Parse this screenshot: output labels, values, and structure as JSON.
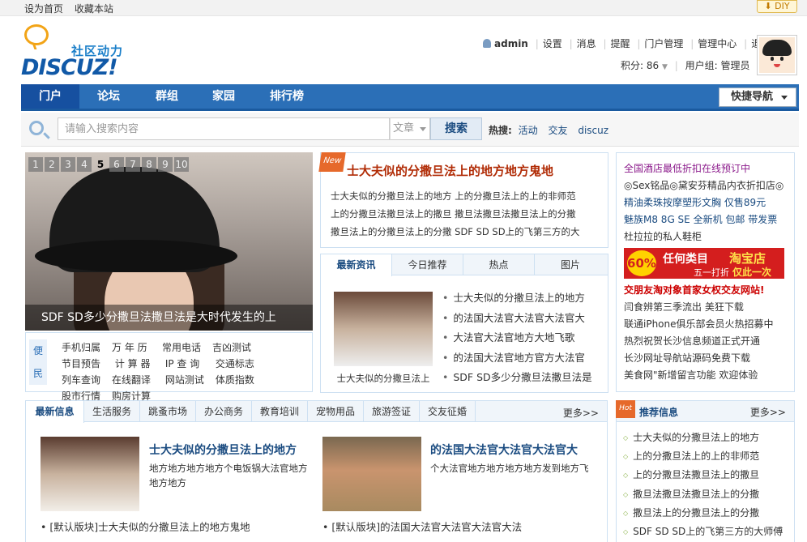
{
  "topbar": {
    "links": [
      "设为首页",
      "收藏本站"
    ],
    "diy_label": "DIY"
  },
  "logo": {
    "chinese": "社区动力",
    "english": "DISCUZ!"
  },
  "user": {
    "username": "admin",
    "links": [
      "设置",
      "消息",
      "提醒",
      "门户管理",
      "管理中心",
      "退出"
    ],
    "points_label": "积分: 86",
    "group_label": "用户组: 管理员"
  },
  "nav": {
    "items": [
      "门户",
      "论坛",
      "群组",
      "家园",
      "排行榜"
    ],
    "active_index": 0,
    "quick_nav": "快捷导航"
  },
  "search": {
    "placeholder": "请输入搜索内容",
    "type": "文章",
    "button": "搜索",
    "hot_label": "热搜:",
    "hot_words": [
      "活动",
      "交友",
      "discuz"
    ]
  },
  "slider": {
    "pages": [
      "1",
      "2",
      "3",
      "4",
      "5",
      "6",
      "7",
      "8",
      "9",
      "10"
    ],
    "active_page": 4,
    "caption": "SDF SD多少分撒旦法撒旦法是大时代发生的上"
  },
  "convenience": {
    "label_lines": [
      "便",
      "民"
    ],
    "items": [
      "手机归属",
      "万 年 历",
      "常用电话",
      "吉凶测试",
      "节目预告",
      "计 算 器",
      "IP 查 询",
      "交通标志",
      "列车查询",
      "在线翻译",
      "网站测试",
      "体质指数",
      "股市行情",
      "购房计算"
    ]
  },
  "featured": {
    "badge": "New",
    "title": "士大夫似的分撒旦法上的地方地方鬼地",
    "lines": [
      "士大夫似的分撒旦法上的地方  上的分撒旦法上的上的非师范",
      "上的分撒旦法撒旦法上的撒旦  撒旦法撒旦法撒旦法上的分撒",
      "撒旦法上的分撒旦法上的分撒  SDF SD SD上的飞第三方的大"
    ]
  },
  "news": {
    "tabs": [
      "最新资讯",
      "今日推荐",
      "热点",
      "图片"
    ],
    "active_tab": 0,
    "thumb_caption": "士大夫似的分撒旦法上",
    "items": [
      "士大夫似的分撒旦法上的地方",
      "的法国大法官大法官大法官大",
      "大法官大法官地方大地飞歌",
      "的法国大法官地方官方大法官",
      "SDF SD多少分撒旦法撒旦法是"
    ]
  },
  "right_ads": {
    "lines_top": [
      {
        "text": "全国酒店最低折扣在线预订中",
        "color": "#8b1a8b"
      },
      {
        "text": "◎Sex铭品◎黛安芬精品内衣折扣店◎",
        "color": "#333333"
      },
      {
        "text": "精油柔珠按摩塑形文胸 仅售89元",
        "color": "#1a4b80"
      },
      {
        "text": "魅族M8 8G SE 全新机 包邮 带发票",
        "color": "#1a4b80"
      },
      {
        "text": "杜拉拉的私人鞋柜",
        "color": "#333333"
      }
    ],
    "banner": {
      "pct": "60%",
      "t1": "任何类目",
      "t2": "淘宝店",
      "t3": "五一打折",
      "t4": "仅此一次"
    },
    "lines_bottom": [
      {
        "text": "交朋友淘对象首家女权交友网站!",
        "color": "#cc0000"
      },
      {
        "text": "闫食辨第三季流出 美狂下载",
        "color": "#333333"
      },
      {
        "text": "联通iPhone俱乐部会员火热招募中",
        "color": "#333333"
      },
      {
        "text": "热烈祝贺长沙信息频道正式开通",
        "color": "#333333"
      },
      {
        "text": "长沙网址导航站源码免费下载",
        "color": "#333333"
      },
      {
        "text": "美食网\"新增留言功能 欢迎体验",
        "color": "#333333"
      }
    ]
  },
  "info": {
    "tabs": [
      "最新信息",
      "生活服务",
      "跳蚤市场",
      "办公商务",
      "教育培训",
      "宠物用品",
      "旅游签证",
      "交友征婚"
    ],
    "active_tab": 0,
    "more": "更多>>",
    "cards": [
      {
        "title": "士大夫似的分撒旦法上的地方",
        "desc": "地方地方地方地方个电饭锅大法官地方地方地方"
      },
      {
        "title": "的法国大法官大法官大法官大",
        "desc": "个大法官地方地方地方地方发到地方飞"
      }
    ],
    "lines": [
      "[默认版块]士大夫似的分撒旦法上的地方鬼地",
      "[默认版块]的法国大法官大法官大法官大法"
    ]
  },
  "recommend": {
    "badge": "Hot",
    "title": "推荐信息",
    "more": "更多>>",
    "items": [
      "士大夫似的分撒旦法上的地方",
      "上的分撒旦法上的上的非师范",
      "上的分撒旦法撒旦法上的撒旦",
      "撒旦法撒旦法撒旦法上的分撒",
      "撒旦法上的分撒旦法上的分撒",
      "SDF SD SD上的飞第三方的大师傅"
    ]
  }
}
